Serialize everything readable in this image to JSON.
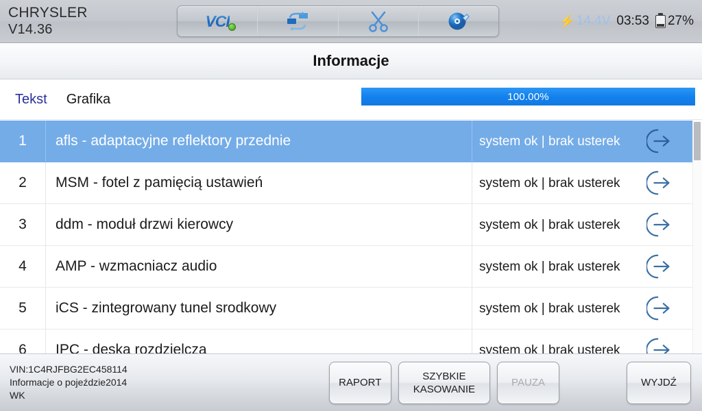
{
  "topbar": {
    "brand_name": "CHRYSLER",
    "brand_version": "V14.36",
    "tools": [
      {
        "name": "vci-button",
        "label": "VCI",
        "icon": "vci-icon"
      },
      {
        "name": "data-transfer-button",
        "label": "",
        "icon": "transfer-icon"
      },
      {
        "name": "snip-button",
        "label": "",
        "icon": "scissors-icon"
      },
      {
        "name": "record-button",
        "label": "",
        "icon": "disc-pen-icon"
      }
    ],
    "status": {
      "voltage": "14.4V",
      "time": "03:53",
      "battery": "27%",
      "bolt_icon": "lightning-bolt-icon",
      "battery_icon": "battery-icon"
    }
  },
  "title": "Informacje",
  "tabs": [
    {
      "label": "Tekst",
      "active": true
    },
    {
      "label": "Grafika",
      "active": false
    }
  ],
  "progress": {
    "label": "100.00%",
    "percent": 100
  },
  "table": {
    "rows": [
      {
        "num": "1",
        "name": "afls - adaptacyjne reflektory przednie",
        "status": "system ok | brak usterek",
        "selected": true
      },
      {
        "num": "2",
        "name": "MSM - fotel z pamięcią ustawień",
        "status": "system ok | brak usterek",
        "selected": false
      },
      {
        "num": "3",
        "name": "ddm - moduł drzwi kierowcy",
        "status": "system ok | brak usterek",
        "selected": false
      },
      {
        "num": "4",
        "name": "AMP - wzmacniacz audio",
        "status": "system ok | brak usterek",
        "selected": false
      },
      {
        "num": "5",
        "name": "iCS - zintegrowany tunel srodkowy",
        "status": "system ok | brak usterek",
        "selected": false
      },
      {
        "num": "6",
        "name": "IPC - deska rozdzielcza",
        "status": "system ok | brak usterek",
        "selected": false
      }
    ],
    "action_icon": "arrow-into-circle-icon"
  },
  "footer": {
    "vin": "VIN:1C4RJFBG2EC458114",
    "vehicle_info": "Informacje o pojeździe2014",
    "platform": "WK",
    "buttons": [
      {
        "name": "report-button",
        "label": "RAPORT",
        "disabled": false
      },
      {
        "name": "quick-erase-button",
        "label": "SZYBKIE KASOWANIE",
        "disabled": false
      },
      {
        "name": "pause-button",
        "label": "PAUZA",
        "disabled": true
      },
      {
        "name": "exit-button",
        "label": "WYJDŹ",
        "disabled": false
      }
    ]
  },
  "colors": {
    "accent_blue": "#1280ec",
    "selected_row": "#74ace8",
    "tab_active": "#28309c",
    "voltage": "#9fc0e8"
  }
}
